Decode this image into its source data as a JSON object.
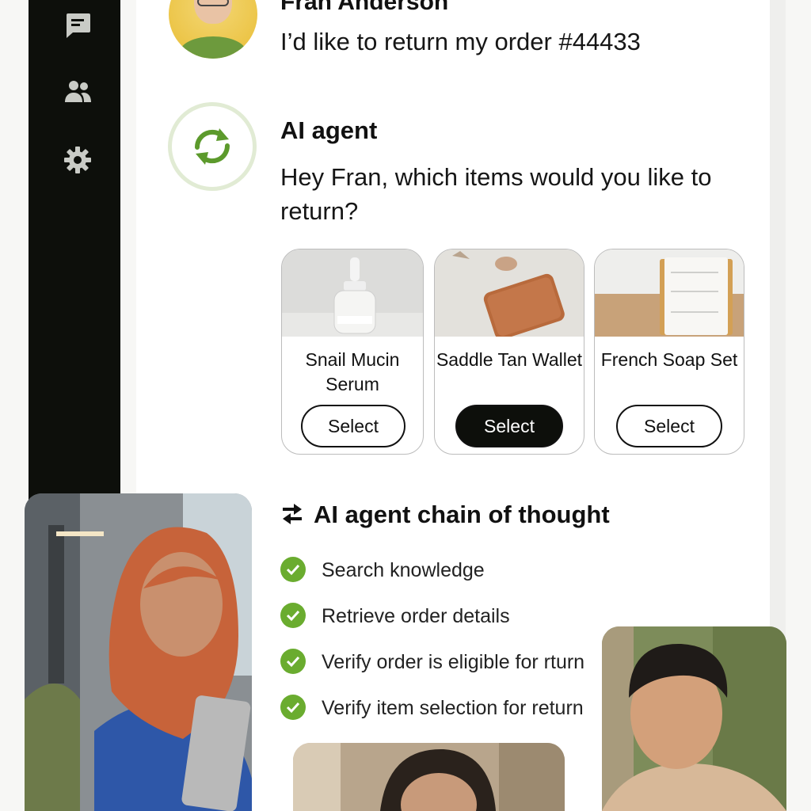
{
  "colors": {
    "sidebar": "#0d0f0b",
    "panel": "#ffffff",
    "accent_green": "#6aac2f",
    "selected_button": "#0d0f0b"
  },
  "sidebar": {
    "icons": [
      "chat-icon",
      "users-icon",
      "gear-icon"
    ]
  },
  "conversation": {
    "customer": {
      "name": "Fran Anderson",
      "message": "I’d like to return my order #44433"
    },
    "agent": {
      "name": "AI agent",
      "message": "Hey Fran, which items would you like to return?"
    }
  },
  "products": [
    {
      "title": "Snail Mucin Serum",
      "button": "Select",
      "selected": false
    },
    {
      "title": "Saddle Tan Wallet",
      "button": "Select",
      "selected": true
    },
    {
      "title": "French Soap Set",
      "button": "Select",
      "selected": false
    }
  ],
  "chain_of_thought": {
    "title": "AI agent chain of thought",
    "steps": [
      {
        "label": "Search knowledge",
        "done": true
      },
      {
        "label": "Retrieve order details",
        "done": true
      },
      {
        "label": "Verify order is eligible for rturn",
        "done": true
      },
      {
        "label": "Verify item selection for return",
        "done": true
      }
    ]
  }
}
